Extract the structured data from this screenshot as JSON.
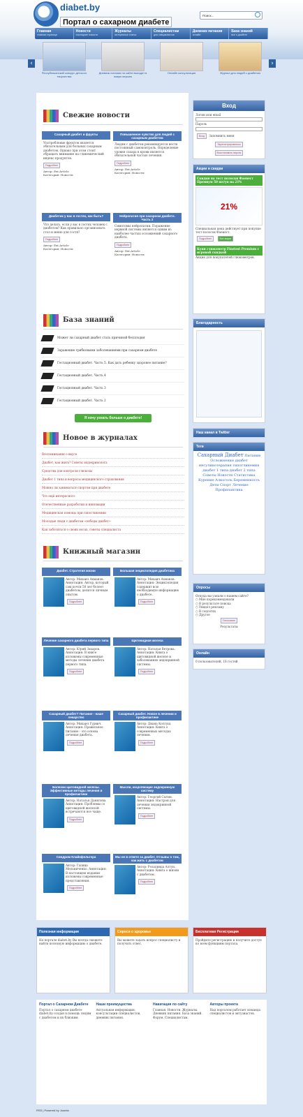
{
  "header": {
    "logo": "diabet.by",
    "subtitle": "Портал о сахарном диабете",
    "search_placeholder": "Поиск..."
  },
  "nav": [
    {
      "label": "Главная",
      "sub": "главная страница"
    },
    {
      "label": "Новости",
      "sub": "последние новости"
    },
    {
      "label": "Журналы",
      "sub": "интересные статьи"
    },
    {
      "label": "Специалистам",
      "sub": "для специалистов"
    },
    {
      "label": "Дневник питания",
      "sub": "онлайн"
    },
    {
      "label": "База знаний",
      "sub": "все о диабете"
    }
  ],
  "slides": [
    "Республиканский конкурс детского творчества",
    "Дневник питания на сайте выходит в новую версию",
    "Онлайн консультации",
    "Журнал для людей с диабетом"
  ],
  "news": {
    "title": "Свежие новости",
    "cards": [
      {
        "title": "Сахарный диабет и фрукты",
        "text": "Употребление фруктов является обязательным для больных сахарным диабетом. Однако при этом стоит обращать внимание на гликемический индекс продуктов.",
        "more": "Подробнее",
        "author": "Автор: Ext.Article",
        "category": "Категория: Новости"
      },
      {
        "title": "Повышенное чувство для людей с сахарным диабетом",
        "text": "Людям с диабетом рекомендуется вести постоянный самоконтроль. Определение уровня сахара в крови является обязательной частью лечения.",
        "more": "Подробнее",
        "author": "Автор: Ext.Article",
        "category": "Категория: Новости"
      },
      {
        "title": "Диабетик у вас в гостях, как быть?",
        "text": "Что делать, если у вас в гостях человек с диабетом? Как правильно организовать стол и меню для гостя?",
        "more": "Подробнее",
        "author": "Автор: Ext.Article",
        "category": "Категория: Новости"
      },
      {
        "title": "Нейропатия при сахарном диабете. Часть 2",
        "text": "Симптомы нейропатии. Поражение нервной системы является одним из наиболее частых осложнений сахарного диабета.",
        "more": "Подробнее",
        "author": "Автор: Ext.Article",
        "category": "Категория: Новости"
      }
    ]
  },
  "kb": {
    "title": "База знаний",
    "items": [
      "Может ли сахарный диабет стать причиной бесплодия",
      "Заражение грибковыми заболеваниями при сахарном диабете",
      "Гестационный диабет. Часть 5. Как дать ребенку здоровое питание?",
      "Гестационный диабет. Часть 4",
      "Гестационный диабет. Часть 3",
      "Гестационный диабет. Часть 2"
    ],
    "button": "Я хочу узнать больше о диабете!"
  },
  "journals": {
    "title": "Новое в журналах",
    "items": [
      "Воспоминания о вкусе",
      "Диабет, как жить? Советы эндокринолога",
      "Средства для контроля глюкозы",
      "Диабет 1 типа и вопросы медицинского страхования",
      "Можно ли заниматься спортом при диабете",
      "Что ещё интересного",
      "Отечественные разработки и инновации",
      "Медицинская помощь при гипогликемии",
      "Молодые люди с диабетом «победы диабет»",
      "Как заботиться о своих ногах, советы специалиста"
    ]
  },
  "books": {
    "title": "Книжный магазин",
    "items": [
      {
        "title": "Диабет. Стратегия жизни",
        "text": "Автор: Михаил Ахманов. Аннотация: Автор, который сам почти 50 лет болеет диабетом, делится личным опытом.",
        "more": "Подробнее"
      },
      {
        "title": "Большая энциклопедия диабетика",
        "text": "Автор: Михаил Ахманов. Аннотация: Энциклопедия содержит всю необходимую информацию о диабете.",
        "more": "Подробнее"
      },
      {
        "title": "Лечение сахарного диабета первого типа",
        "text": "Автор: Юрий Захаров. Аннотация: В книге изложены современные методы лечения диабета первого типа.",
        "more": "Подробнее"
      },
      {
        "title": "Щитовидная железа",
        "text": "Автор: Наталья Ветрова. Аннотация: Книга о щитовидной железе и заболеваниях эндокринной системы.",
        "more": "Подробнее"
      },
      {
        "title": "Сахарный диабет? Питание - наше лекарство",
        "text": "Автор: Михаил Гурвич. Аннотация: Правильное питание - это основа лечения диабета.",
        "more": "Подробнее"
      },
      {
        "title": "Сахарный диабет. Новое в лечении и профилактике",
        "text": "Автор: Диана Колгуш. Аннотация: Книга о современных методах лечения.",
        "more": "Подробнее"
      },
      {
        "title": "Болезни щитовидной железы. Эффективные методы лечения и профилактики",
        "text": "Автор: Наталья Данилова. Аннотация: Проблемы со щитовидной железой встречаются все чаще.",
        "more": "Подробнее"
      },
      {
        "title": "Мысли, исцеляющие эндокринную систему",
        "text": "Автор: Георгий Сытин. Аннотация: Настрои для лечения эндокринной системы.",
        "more": "Подробнее"
      },
      {
        "title": "Синдром Клайнфельтера",
        "text": "Автор: Галина Мельниченко. Аннотация: В настоящем издании изложены современные представления.",
        "more": "Подробнее"
      },
      {
        "title": "Мы не в ответе за диабет. Отзывы о том, как жить с диабетом",
        "text": "Автор: Розалинда Алтун. Аннотация: Книга о жизни с диабетом.",
        "more": "Подробнее"
      }
    ]
  },
  "sidebar": {
    "login": {
      "title": "Вход",
      "user_label": "Логин или email",
      "pass_label": "Пароль",
      "submit": "Вход",
      "remember": "Запомнить меня",
      "register": "Зарегистрироваться",
      "forgot": "Восстановить пароль"
    },
    "promo": {
      "title": "Акции и скидки",
      "ad_title": "Скидки на тест полоски Фаенест Премиум 50 шт/уп на 21%",
      "ad_text": "Специальная цена действует при покупке тест-полосок Фаенест.",
      "more": "Подробнее",
      "all": "Все акции",
      "ad2_title": "Купи глюкометр Finetest Premium с игровой скидкой",
      "ad2_text": "Акция для покупателей глюкометров."
    },
    "thanks": {
      "title": "Благодарность"
    },
    "twitter": {
      "title": "Наш канал в Twitter"
    },
    "tags": {
      "title": "Теги",
      "words": [
        "Сахарный Диабет",
        "Питание",
        "Осложнения",
        "диабет инсулинотерапия",
        "гипогликемия",
        "диабет 1 типа",
        "диабет 2 типа",
        "Советы",
        "Новости",
        "Статистика",
        "Курение",
        "Алкоголь",
        "Беременность",
        "Дети",
        "Спорт",
        "Лечение",
        "Профилактика"
      ]
    },
    "poll": {
      "title": "Опросы",
      "question": "Откуда вы узнали о нашем сайте?",
      "options": [
        "Мне порекомендовали",
        "В результате поиска",
        "Увидел рекламу",
        "В соцсетях",
        "Другое"
      ],
      "vote": "Голосовать",
      "results": "Результаты"
    },
    "online": {
      "title": "Онлайн",
      "text": "0 пользователей, 18 гостей"
    }
  },
  "bottom": [
    {
      "title": "Полезная информация",
      "text": "На портале diabet.by Вы всегда сможете найти полезную информацию о диабете."
    },
    {
      "title": "Спроси о здоровье",
      "text": "Вы можете задать вопрос специалисту и получить ответ."
    },
    {
      "title": "Бесплатная Регистрация",
      "text": "Пройдите регистрацию и получите доступ ко всем функциям портала."
    }
  ],
  "footer": [
    {
      "title": "Портал о Сахарном Диабете",
      "text": "Портал о сахарном диабете diabet.by создан в помощь людям с диабетом и их близким."
    },
    {
      "title": "Наши преимущества",
      "text": "Актуальная информация, консультации специалистов, дневник питания."
    },
    {
      "title": "Навигация по сайту",
      "text": "Главная. Новости. Журналы. Дневник питания. База знаний. Форум. Специалистам."
    },
    {
      "title": "Авторы проекта",
      "text": "Над порталом работает команда специалистов и энтузиастов."
    }
  ],
  "copyright": "RSS | Powered by Joomla"
}
